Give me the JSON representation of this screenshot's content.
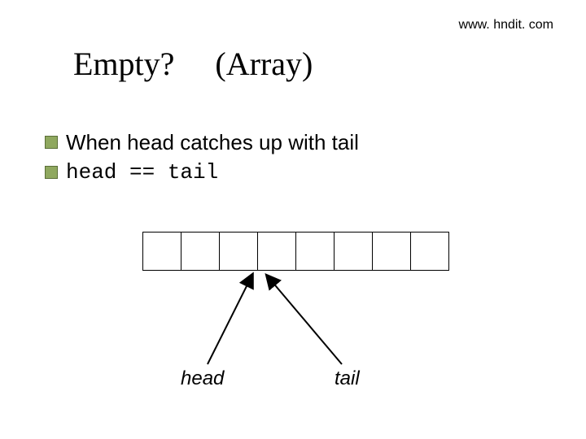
{
  "url": "www. hndit. com",
  "title_left": "Empty?",
  "title_right": "(Array)",
  "bullets": {
    "b1_pre": "When ",
    "b1_post": "head catches up with tail",
    "b2": "head == tail"
  },
  "diagram": {
    "cells": 8,
    "head_label": "head",
    "tail_label": "tail"
  }
}
